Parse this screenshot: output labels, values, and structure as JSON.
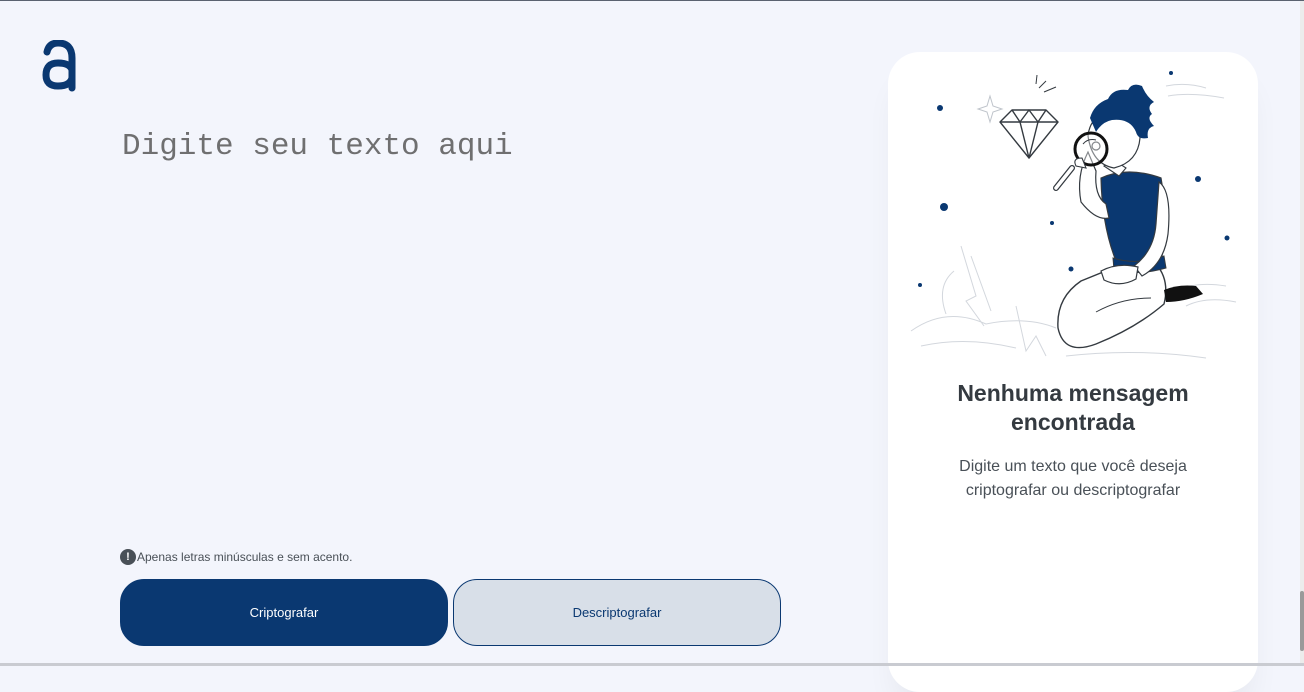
{
  "logo": {
    "icon": "alura-a-logo"
  },
  "input": {
    "placeholder": "Digite seu texto aqui",
    "value": ""
  },
  "hint": {
    "icon": "exclamation-icon",
    "glyph": "!",
    "text": "Apenas letras minúsculas e sem acento."
  },
  "buttons": {
    "encrypt_label": "Criptografar",
    "decrypt_label": "Descriptografar"
  },
  "result": {
    "title_line1": "Nenhuma mensagem",
    "title_line2": "encontrada",
    "desc_line1": "Digite um texto que você deseja",
    "desc_line2": "criptografar ou descriptografar",
    "illustration": "person-with-magnifier-icon"
  },
  "colors": {
    "background": "#F3F5FC",
    "primary": "#0A3871",
    "secondary": "#D8DFE8",
    "card": "#FFFFFF",
    "title": "#343A40",
    "text": "#495057"
  }
}
